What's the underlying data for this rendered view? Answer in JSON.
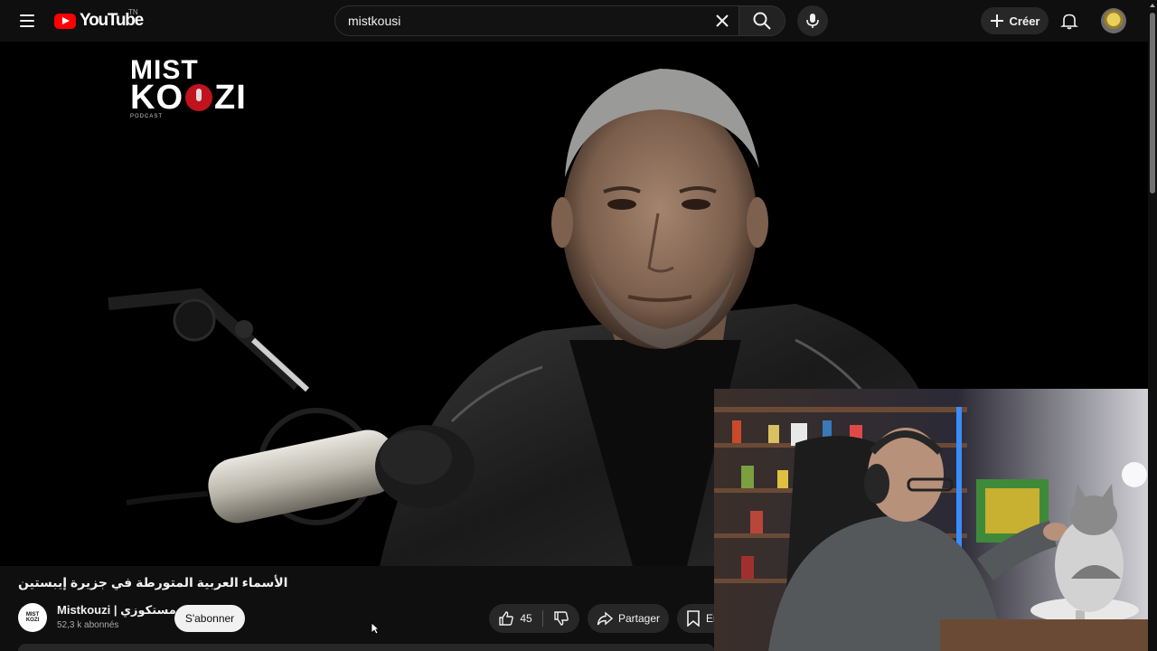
{
  "header": {
    "logo_text": "YouTube",
    "country_code": "TN",
    "search_value": "mistkousi",
    "create_label": "Créer"
  },
  "video": {
    "brand_line1": "MIST",
    "brand_line2a": "KO",
    "brand_line2b": "ZI",
    "brand_line3": "PODCAST",
    "title": "الأسماء العربية المتورطة في جزيرة إيبستين"
  },
  "channel": {
    "avatar_line1": "MIST",
    "avatar_line2": "KOZI",
    "name": "Mistkouzi | مستكوزي",
    "subscribers": "52,3 k abonnés",
    "subscribe_label": "S'abonner"
  },
  "actions": {
    "like_count": "45",
    "share_label": "Partager",
    "save_label": "En"
  },
  "colors": {
    "background": "#0f0f0f",
    "brand_red": "#ff0000",
    "button_bg": "#272727"
  }
}
